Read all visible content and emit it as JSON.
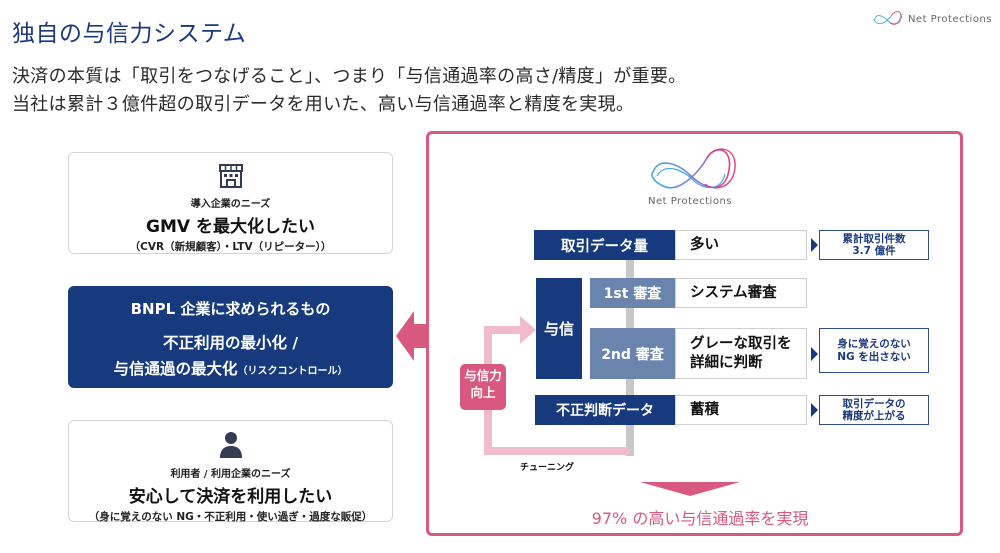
{
  "header": {
    "title": "独自の与信力システム",
    "subtitle_line1": "決済の本質は「取引をつなげること」、つまり「与信通過率の高さ/精度」が重要。",
    "subtitle_line2": "当社は累計３億件超の取引データを用いた、高い与信通過率と精度を実現。",
    "brand_name": "Net Protections",
    "brand_icon": "net-protections-logo-icon"
  },
  "left_cards": {
    "merchant": {
      "icon": "storefront-icon",
      "label": "導入企業のニーズ",
      "headline": "GMV を最大化したい",
      "note": "（CVR（新規顧客）・LTV（リピーター））"
    },
    "bnpl": {
      "line1": "BNPL 企業に求められるもの",
      "line2": "不正利用の最小化 /",
      "line3": "与信通過の最大化",
      "line3_note": "（リスクコントロール）"
    },
    "user": {
      "icon": "person-icon",
      "label": "利用者 / 利用企業のニーズ",
      "headline": "安心して決済を利用したい",
      "note": "（身に覚えのない NG・不正利用・使い過ぎ・過度な販促）"
    }
  },
  "system": {
    "logo_text": "Net Protections",
    "rows": {
      "data_volume": {
        "label": "取引データ量",
        "value": "多い",
        "result": [
          "累計取引件数",
          "3.7 億件"
        ]
      },
      "credit_label": "与信",
      "first_review": {
        "label": "1st 審査",
        "value": "システム審査"
      },
      "second_review": {
        "label": "2nd 審査",
        "value": [
          "グレーな取引を",
          "詳細に判断"
        ],
        "result": [
          "身に覚えのない",
          "NG を出さない"
        ]
      },
      "fraud_data": {
        "label": "不正判断データ",
        "value": "蓄積",
        "result": [
          "取引データの",
          "精度が上がる"
        ]
      }
    },
    "boost_label": [
      "与信力",
      "向上"
    ],
    "tuning_label": "チューニング",
    "result_text": "97% の高い与信通過率を実現"
  },
  "colors": {
    "navy": "#173a7e",
    "mid_blue": "#6a84ad",
    "pink": "#d9587f",
    "light_pink": "#f0bccd",
    "gray_line": "#c8c8c8"
  }
}
